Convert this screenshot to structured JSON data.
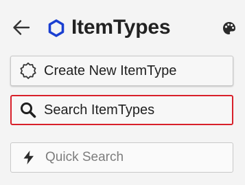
{
  "header": {
    "title": "ItemTypes",
    "back_icon": "arrow-left-icon",
    "title_icon": "hexagon-icon",
    "action_icon": "palette-icon"
  },
  "actions": {
    "create_label": "Create New ItemType",
    "create_icon": "badge-outline-icon",
    "search_label": "Search ItemTypes",
    "search_icon": "magnifier-icon"
  },
  "quick_search": {
    "placeholder": "Quick Search",
    "value": "",
    "icon": "lightning-bolt-icon"
  },
  "colors": {
    "accent_blue": "#1a3fd1",
    "highlight_red": "#d8202a",
    "text": "#212121",
    "placeholder": "#7d7d7d",
    "background": "#f4f4f4"
  }
}
